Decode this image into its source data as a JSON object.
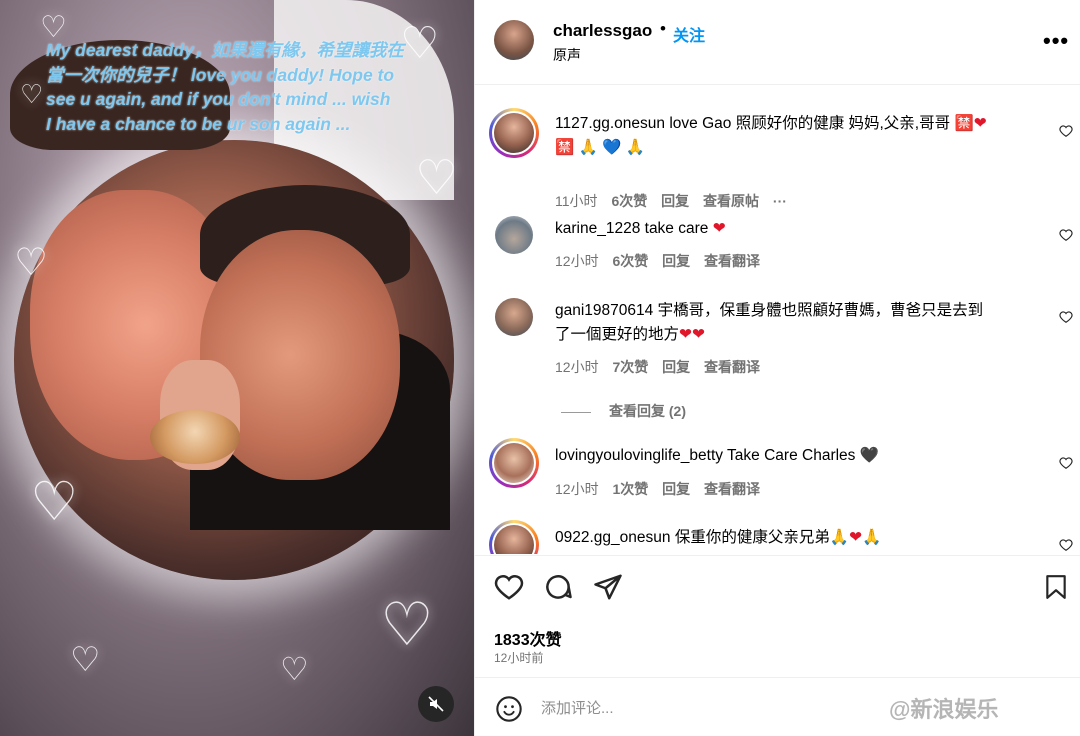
{
  "story": {
    "lines": [
      "My dearest daddy，如果還有緣，希望讓我在",
      "當一次你的兒子！ love you daddy! Hope to",
      "see u again, and if you don't mind ... wish",
      "I have a chance to be ur son again ..."
    ],
    "mute_icon": "mute-icon"
  },
  "header": {
    "username": "charlessgao",
    "dot": "•",
    "follow_label": "关注",
    "audio": "原声",
    "more_icon": "more-icon"
  },
  "comments": [
    {
      "username": "1127.gg.onesun",
      "text": " love Gao 照顾好你的健康 妈妈,父亲,哥哥 ",
      "emojis": [
        "🈲",
        "❤",
        "🈲",
        "🙏",
        "💙",
        "🙏"
      ],
      "time": "11小时",
      "likes": "6次赞",
      "reply": "回复",
      "action": "查看原帖",
      "extra": "···"
    },
    {
      "username": "karine_1228",
      "text": " take care ",
      "emojis": [
        "❤"
      ],
      "time": "12小时",
      "likes": "6次赞",
      "reply": "回复",
      "action": "查看翻译"
    },
    {
      "username": "gani19870614",
      "text_line1": " 宇橋哥，保重身體也照顧好曹媽，曹爸只是去到",
      "text_line2": "了一個更好的地方",
      "emojis": [
        "❤",
        "❤"
      ],
      "time": "12小时",
      "likes": "7次赞",
      "reply": "回复",
      "action": "查看翻译",
      "view_replies": "查看回复 (2)"
    },
    {
      "username": "lovingyoulovinglife_betty",
      "text": " Take Care Charles ",
      "emojis": [
        "🖤"
      ],
      "time": "12小时",
      "likes": "1次赞",
      "reply": "回复",
      "action": "查看翻译"
    },
    {
      "username": "0922.gg_onesun",
      "text": " 保重你的健康父亲兄弟",
      "emojis": [
        "🙏",
        "❤",
        "🙏"
      ]
    }
  ],
  "actions": {
    "likes_count": "1833次赞",
    "time_ago": "12小时前"
  },
  "add_comment": {
    "placeholder": "添加评论...",
    "watermark": "@新浪娱乐"
  }
}
